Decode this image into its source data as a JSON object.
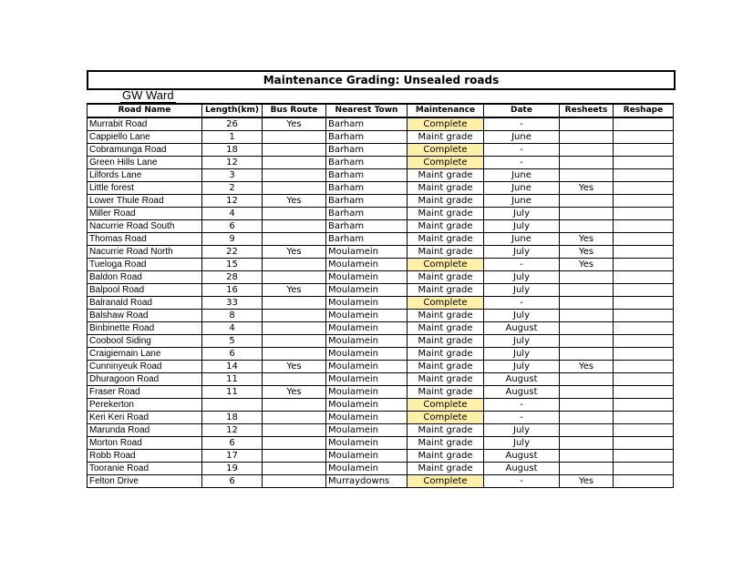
{
  "title": "Maintenance Grading: Unsealed roads",
  "ward": "GW Ward",
  "columns": [
    "Road Name",
    "Length(km)",
    "Bus Route",
    "Nearest Town",
    "Maintenance",
    "Date",
    "Resheets",
    "Reshape"
  ],
  "rows": [
    [
      "Murrabit Road",
      "26",
      "Yes",
      "Barham",
      "Complete",
      "-",
      "",
      ""
    ],
    [
      "Cappiello Lane",
      "1",
      "",
      "Barham",
      "Maint grade",
      "June",
      "",
      ""
    ],
    [
      "Cobramunga Road",
      "18",
      "",
      "Barham",
      "Complete",
      "-",
      "",
      ""
    ],
    [
      "Green Hills Lane",
      "12",
      "",
      "Barham",
      "Complete",
      "-",
      "",
      ""
    ],
    [
      "Lilfords Lane",
      "3",
      "",
      "Barham",
      "Maint grade",
      "June",
      "",
      ""
    ],
    [
      "Little forest",
      "2",
      "",
      "Barham",
      "Maint grade",
      "June",
      "Yes",
      ""
    ],
    [
      "Lower Thule Road",
      "12",
      "Yes",
      "Barham",
      "Maint grade",
      "June",
      "",
      ""
    ],
    [
      "Miller Road",
      "4",
      "",
      "Barham",
      "Maint grade",
      "July",
      "",
      ""
    ],
    [
      "Nacurrie Road South",
      "6",
      "",
      "Barham",
      "Maint grade",
      "July",
      "",
      ""
    ],
    [
      "Thomas Road",
      "9",
      "",
      "Barham",
      "Maint grade",
      "June",
      "Yes",
      ""
    ],
    [
      "Nacurrie Road North",
      "22",
      "Yes",
      "Moulamein",
      "Maint grade",
      "July",
      "Yes",
      ""
    ],
    [
      "Tueloga Road",
      "15",
      "",
      "Moulamein",
      "Complete",
      "-",
      "Yes",
      ""
    ],
    [
      "Baldon Road",
      "28",
      "",
      "Moulamein",
      "Maint grade",
      "July",
      "",
      ""
    ],
    [
      "Balpool Road",
      "16",
      "Yes",
      "Moulamein",
      "Maint grade",
      "July",
      "",
      ""
    ],
    [
      "Balranald Road",
      "33",
      "",
      "Moulamein",
      "Complete",
      "-",
      "",
      ""
    ],
    [
      "Balshaw Road",
      "8",
      "",
      "Moulamein",
      "Maint grade",
      "July",
      "",
      ""
    ],
    [
      "Binbinette Road",
      "4",
      "",
      "Moulamein",
      "Maint grade",
      "August",
      "",
      ""
    ],
    [
      "Coobool Siding",
      "5",
      "",
      "Moulamein",
      "Maint grade",
      "July",
      "",
      ""
    ],
    [
      "Craigiemain Lane",
      "6",
      "",
      "Moulamein",
      "Maint grade",
      "July",
      "",
      ""
    ],
    [
      "Cunninyeuk Road",
      "14",
      "Yes",
      "Moulamein",
      "Maint grade",
      "July",
      "Yes",
      ""
    ],
    [
      "Dhuragoon Road",
      "11",
      "",
      "Moulamein",
      "Maint grade",
      "August",
      "",
      ""
    ],
    [
      "Fraser Road",
      "11",
      "Yes",
      "Moulamein",
      "Maint grade",
      "August",
      "",
      ""
    ],
    [
      "Perekerton",
      "",
      "",
      "Moulamein",
      "Complete",
      "-",
      "",
      ""
    ],
    [
      "Keri Keri Road",
      "18",
      "",
      "Moulamein",
      "Complete",
      "-",
      "",
      ""
    ],
    [
      "Marunda Road",
      "12",
      "",
      "Moulamein",
      "Maint grade",
      "July",
      "",
      ""
    ],
    [
      "Morton Road",
      "6",
      "",
      "Moulamein",
      "Maint grade",
      "July",
      "",
      ""
    ],
    [
      "Robb Road",
      "17",
      "",
      "Moulamein",
      "Maint grade",
      "August",
      "",
      ""
    ],
    [
      "Tooranie Road",
      "19",
      "",
      "Moulamein",
      "Maint grade",
      "August",
      "",
      ""
    ],
    [
      "Felton Drive",
      "6",
      "",
      "Murraydowns",
      "Complete",
      "-",
      "Yes",
      ""
    ]
  ],
  "colors": {
    "complete_highlight": "#fdf0a6",
    "border": "#000000"
  }
}
